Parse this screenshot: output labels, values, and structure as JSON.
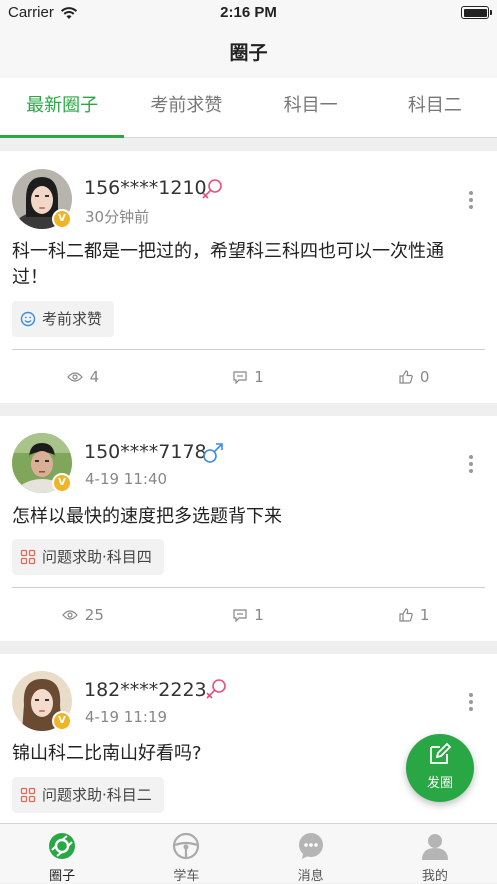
{
  "status_bar": {
    "carrier": "Carrier",
    "time": "2:16 PM"
  },
  "nav": {
    "title": "圈子"
  },
  "tabs": [
    {
      "label": "最新圈子",
      "active": true
    },
    {
      "label": "考前求赞",
      "active": false
    },
    {
      "label": "科目一",
      "active": false
    },
    {
      "label": "科目二",
      "active": false
    }
  ],
  "posts": [
    {
      "user": "156****1210",
      "gender": "female",
      "time": "30分钟前",
      "badge": "V",
      "content": "科一科二都是一把过的，希望科三科四也可以一次性通过！",
      "tag": "考前求赞",
      "views": "4",
      "comments": "1",
      "likes": "0"
    },
    {
      "user": "150****7178",
      "gender": "male",
      "time": "4-19 11:40",
      "badge": "V",
      "content": "怎样以最快的速度把多选题背下来",
      "tag": "问题求助·科目四",
      "views": "25",
      "comments": "1",
      "likes": "1"
    },
    {
      "user": "182****2223",
      "gender": "female",
      "time": "4-19 11:19",
      "badge": "V",
      "content": "锦山科二比南山好看吗?",
      "tag": "问题求助·科目二"
    }
  ],
  "fab": {
    "label": "发圈"
  },
  "tabbar": [
    {
      "label": "圈子",
      "icon": "circle-icon",
      "active": true
    },
    {
      "label": "学车",
      "icon": "steering-wheel-icon",
      "active": false
    },
    {
      "label": "消息",
      "icon": "message-icon",
      "active": false
    },
    {
      "label": "我的",
      "icon": "user-icon",
      "active": false
    }
  ],
  "colors": {
    "accent": "#2aa745",
    "female": "#e8507a",
    "male": "#3a8de0",
    "badge": "#f0b429"
  }
}
